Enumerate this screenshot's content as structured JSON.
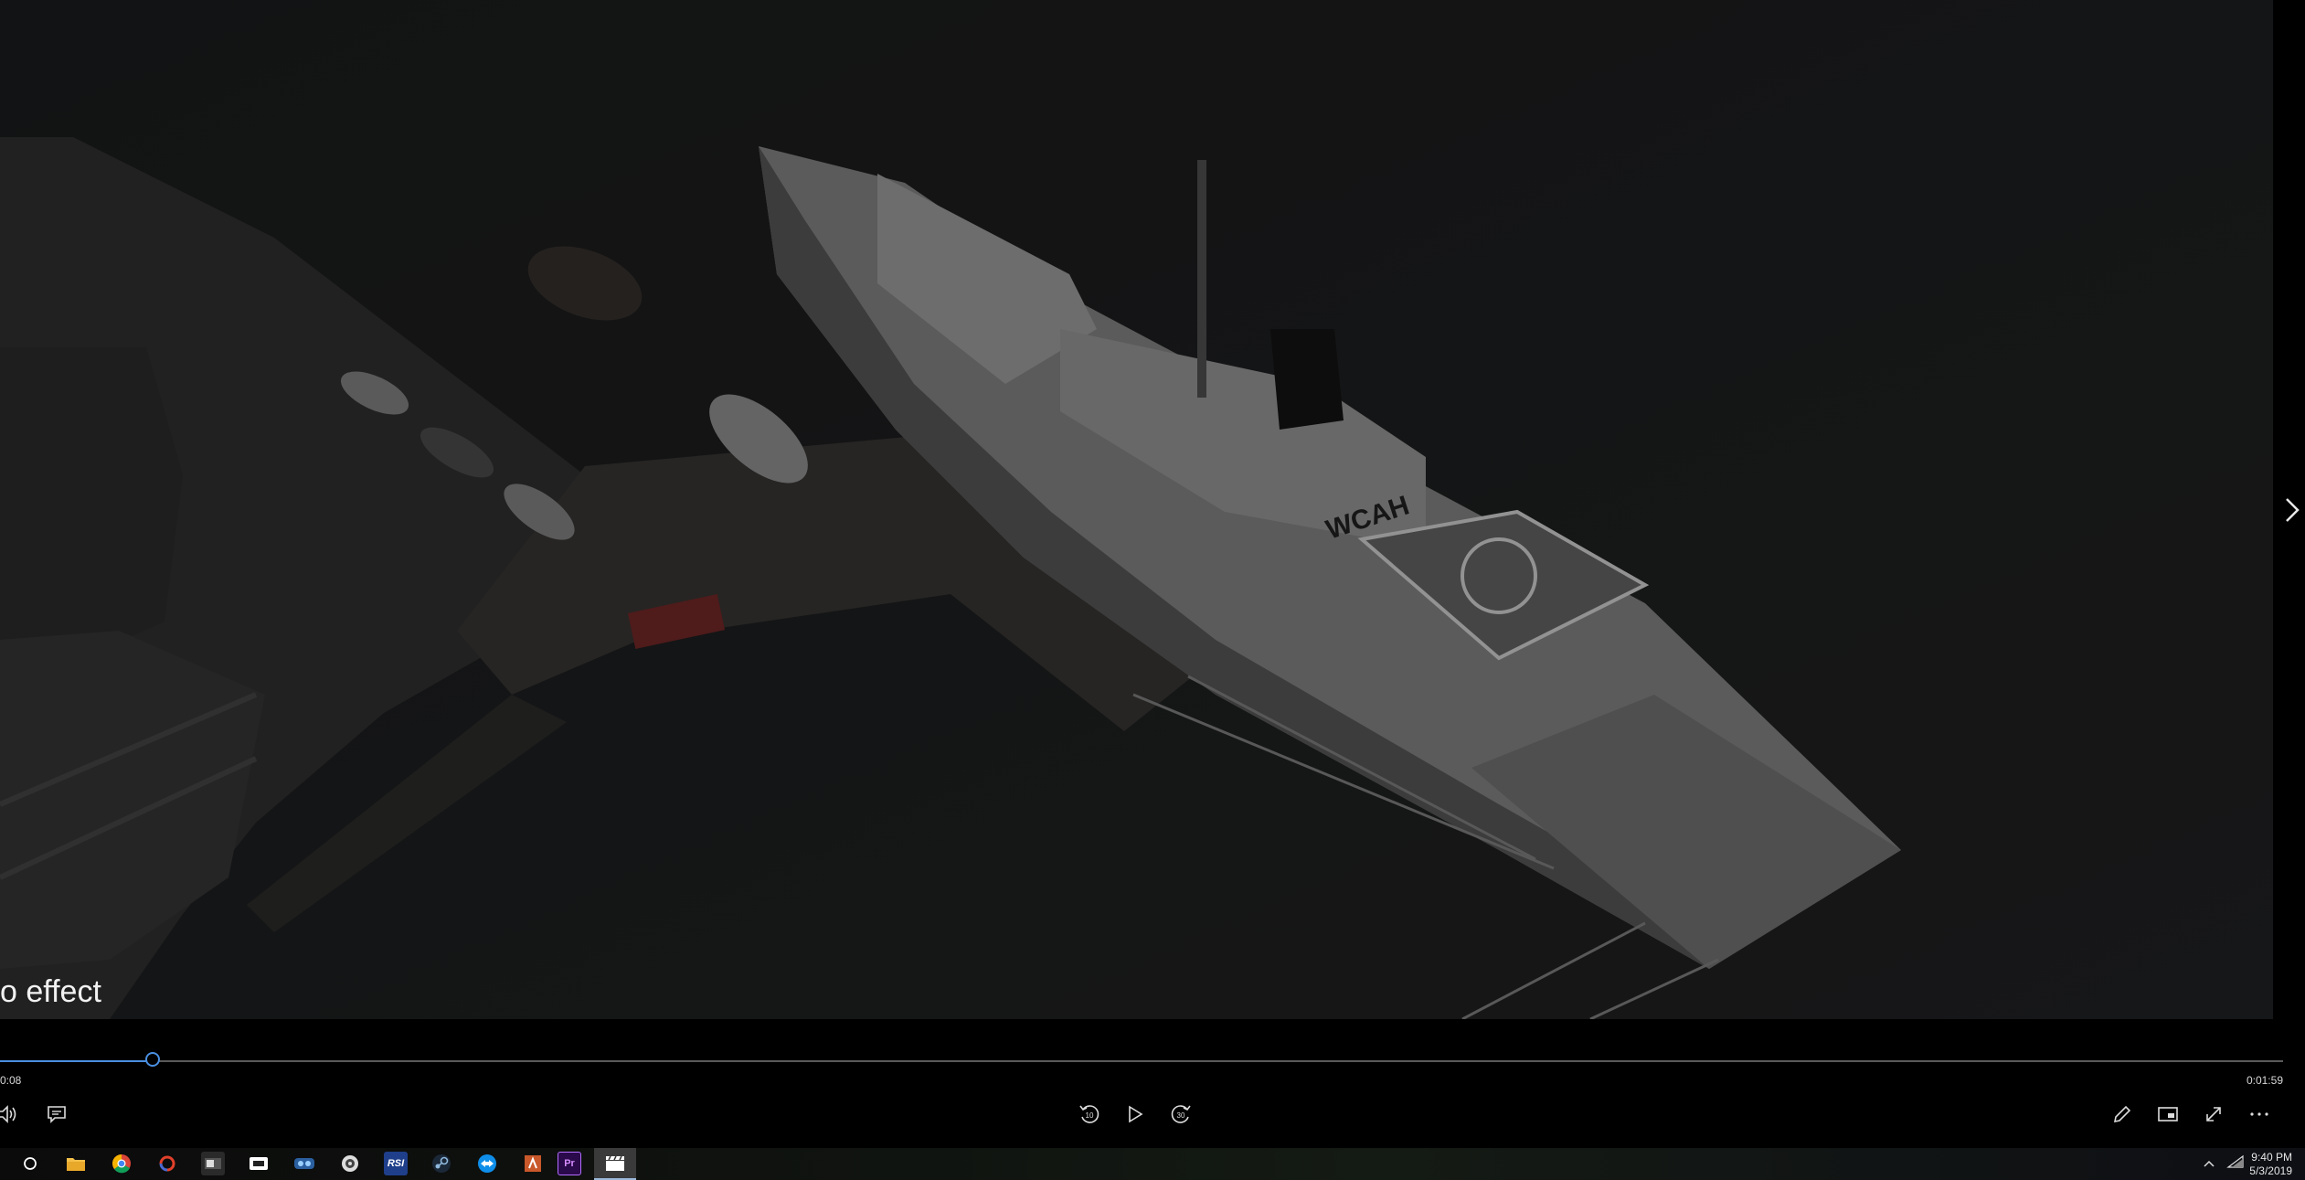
{
  "video": {
    "caption": "o effect",
    "ship_marking": "WCAH"
  },
  "player": {
    "progress_fraction": 0.067,
    "time_elapsed": "0:08",
    "time_total": "0:01:59",
    "buttons": {
      "volume": "volume-icon",
      "subtitles": "subtitles-icon",
      "skip_back": "10",
      "play": "play-icon",
      "skip_forward": "30",
      "edit": "pencil-icon",
      "miniview": "mini-view-icon",
      "fullscreen": "fullscreen-icon",
      "more": "more-icon"
    },
    "accent_color": "#4a8fe0"
  },
  "taskbar": {
    "icons": [
      "cortana-icon",
      "file-explorer-icon",
      "chrome-icon",
      "app-icon",
      "app-icon",
      "app-icon",
      "app-icon",
      "settings-icon",
      "rsi-icon",
      "steam-icon",
      "teamviewer-icon",
      "app-icon",
      "premiere-pro-icon",
      "movies-tv-icon"
    ],
    "rsi_label": "RSI",
    "premiere_label": "Pr",
    "clock_time": "9:40 PM",
    "clock_date": "5/3/2019"
  }
}
